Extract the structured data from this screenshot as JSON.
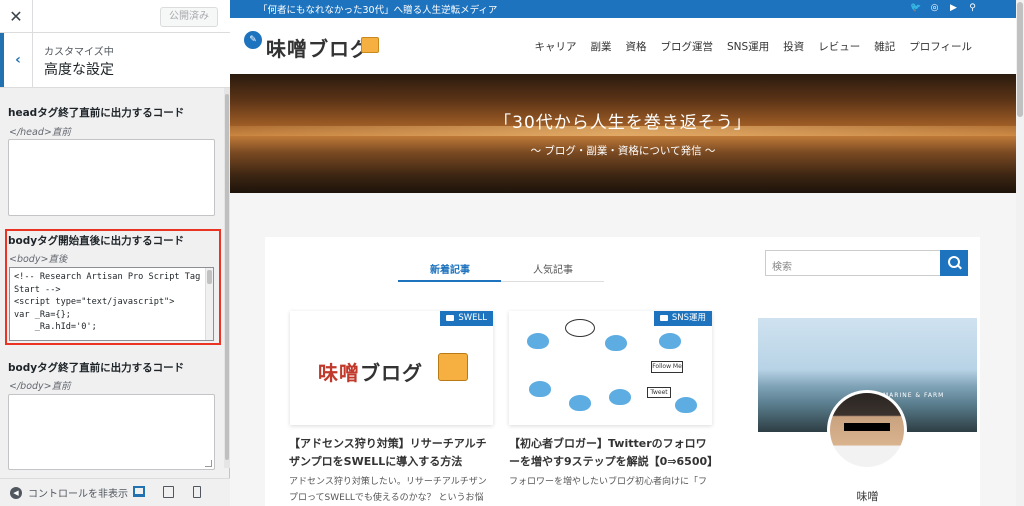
{
  "customizer": {
    "close_icon": "close-icon",
    "publish_label": "公開済み",
    "breadcrumb": "カスタマイズ中",
    "section_title": "高度な設定",
    "fields": [
      {
        "label": "headタグ終了直前に出力するコード",
        "desc": "</head>直前",
        "value": ""
      },
      {
        "label": "bodyタグ開始直後に出力するコード",
        "desc": "<body>直後",
        "code_lines": [
          "<!-- Research Artisan Pro Script Tag",
          "Start -->",
          "<script type=\"text/javascript\">",
          "var _Ra={};",
          "    _Ra.hId='0';"
        ]
      },
      {
        "label": "bodyタグ終了直前に出力するコード",
        "desc": "</body>直前",
        "value": ""
      }
    ],
    "footer": {
      "hide_controls_label": "コントロールを非表示",
      "devices": [
        "desktop-icon",
        "tablet-icon",
        "mobile-icon"
      ]
    },
    "highlight_color": "#ea3323"
  },
  "site": {
    "tagline": "「何者にもなれなかった30代」へ贈る人生逆転メディア",
    "social_icons": [
      "twitter-icon",
      "instagram-icon",
      "youtube-icon",
      "search-icon"
    ],
    "logo_text": "味噌ブログ",
    "nav": [
      "キャリア",
      "副業",
      "資格",
      "ブログ運営",
      "SNS運用",
      "投資",
      "レビュー",
      "雑記",
      "プロフィール"
    ],
    "hero": {
      "title": "「30代から人生を巻き返そう」",
      "subtitle": "〜 ブログ・副業・資格について発信 〜"
    },
    "tabs": [
      "新着記事",
      "人気記事"
    ],
    "cards": [
      {
        "category": "SWELL",
        "image_text_a": "味噌",
        "image_text_b": "ブログ",
        "title": "【アドセンス狩り対策】リサーチアルチザンプロをSWELLに導入する方法",
        "excerpt": "アドセンス狩り対策したい。リサーチアルチザンプロってSWELLでも使えるのかな？ というお悩"
      },
      {
        "category": "SNS運用",
        "image_text_a": "Follow Me",
        "image_text_b": "Tweet",
        "title": "【初心者ブロガー】Twitterのフォロワーを増やす9ステップを解説【0⇒6500】",
        "excerpt": "フォロワーを増やしたいブログ初心者向けに「フ"
      }
    ],
    "sidebar": {
      "search_placeholder": "検索",
      "profile_sign": "MARINE & FARM",
      "profile_name": "味噌"
    },
    "accent_color": "#1e73be"
  }
}
